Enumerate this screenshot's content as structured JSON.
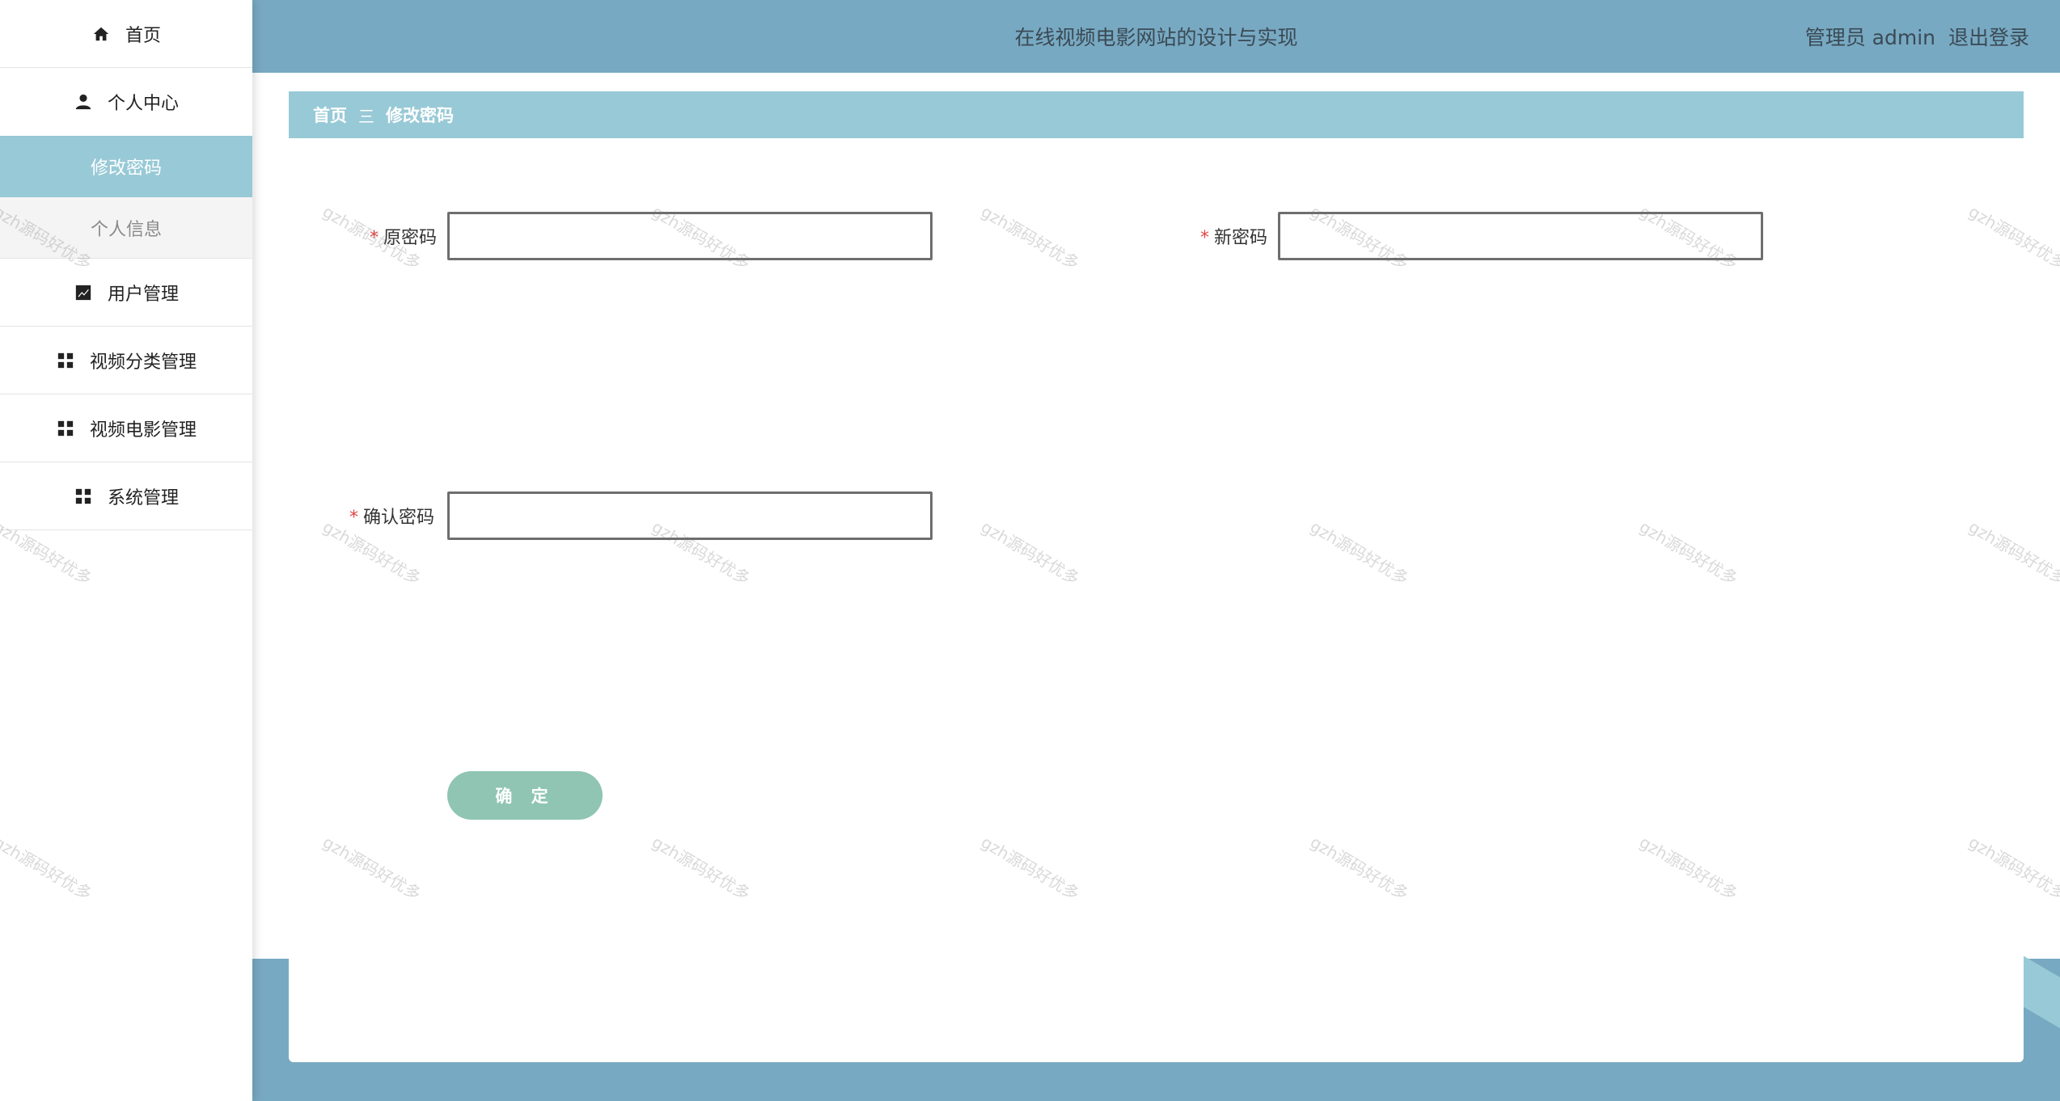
{
  "sidebar": {
    "items": [
      {
        "label": "首页",
        "icon": "home-icon"
      },
      {
        "label": "个人中心",
        "icon": "user-icon",
        "children": [
          {
            "label": "修改密码",
            "active": true
          },
          {
            "label": "个人信息",
            "active": false
          }
        ]
      },
      {
        "label": "用户管理",
        "icon": "chart-icon"
      },
      {
        "label": "视频分类管理",
        "icon": "grid-icon"
      },
      {
        "label": "视频电影管理",
        "icon": "grid-icon"
      },
      {
        "label": "系统管理",
        "icon": "grid-icon"
      }
    ]
  },
  "header": {
    "title": "在线视频电影网站的设计与实现",
    "user_label": "管理员 admin",
    "logout_label": "退出登录"
  },
  "breadcrumb": {
    "home": "首页",
    "separator": "三",
    "current": "修改密码"
  },
  "form": {
    "required_mark": "*",
    "old_password_label": "原密码",
    "new_password_label": "新密码",
    "confirm_password_label": "确认密码",
    "old_password_value": "",
    "new_password_value": "",
    "confirm_password_value": "",
    "submit_label": "确 定"
  },
  "watermark": "gzh源码好优多",
  "colors": {
    "header_bg": "#78a9c2",
    "accent": "#98c9d6",
    "button": "#8fc5b2",
    "required": "#e04545"
  }
}
